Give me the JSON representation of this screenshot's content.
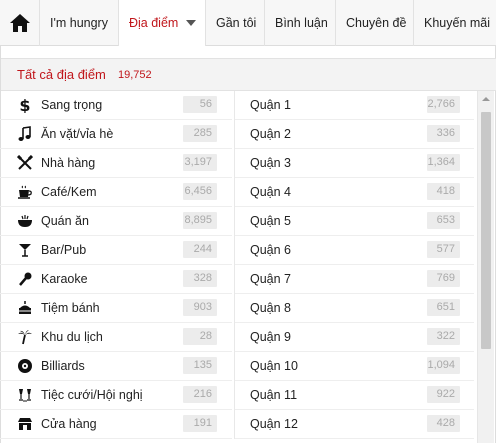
{
  "nav": {
    "home_icon": "home-icon",
    "items": [
      {
        "label": "I'm hungry"
      },
      {
        "label": "Địa điểm"
      },
      {
        "label": "Gần tôi"
      },
      {
        "label": "Bình luận"
      },
      {
        "label": "Chuyên đề"
      },
      {
        "label": "Khuyến mãi"
      }
    ],
    "active_color": "#c0161b"
  },
  "panel": {
    "title": "Tất cả địa điểm",
    "count": "19,752"
  },
  "categories": [
    {
      "label": "Sang trọng",
      "count": "56",
      "icon": "dollar-icon"
    },
    {
      "label": "Ăn vặt/vỉa hè",
      "count": "285",
      "icon": "music-note-icon"
    },
    {
      "label": "Nhà hàng",
      "count": "3,197",
      "icon": "fork-knife-icon"
    },
    {
      "label": "Café/Kem",
      "count": "6,456",
      "icon": "coffee-cup-icon"
    },
    {
      "label": "Quán ăn",
      "count": "8,895",
      "icon": "bowl-icon"
    },
    {
      "label": "Bar/Pub",
      "count": "244",
      "icon": "cocktail-icon"
    },
    {
      "label": "Karaoke",
      "count": "328",
      "icon": "microphone-icon"
    },
    {
      "label": "Tiệm bánh",
      "count": "903",
      "icon": "cake-icon"
    },
    {
      "label": "Khu du lịch",
      "count": "28",
      "icon": "palm-tree-icon"
    },
    {
      "label": "Billiards",
      "count": "135",
      "icon": "billiard-ball-icon"
    },
    {
      "label": "Tiệc cưới/Hội nghị",
      "count": "216",
      "icon": "champagne-glasses-icon"
    },
    {
      "label": "Cửa hàng",
      "count": "191",
      "icon": "shop-icon"
    }
  ],
  "districts": [
    {
      "label": "Quận 1",
      "count": "2,766"
    },
    {
      "label": "Quận 2",
      "count": "336"
    },
    {
      "label": "Quận 3",
      "count": "1,364"
    },
    {
      "label": "Quận 4",
      "count": "418"
    },
    {
      "label": "Quận 5",
      "count": "653"
    },
    {
      "label": "Quận 6",
      "count": "577"
    },
    {
      "label": "Quận 7",
      "count": "769"
    },
    {
      "label": "Quận 8",
      "count": "651"
    },
    {
      "label": "Quận 9",
      "count": "322"
    },
    {
      "label": "Quận 10",
      "count": "1,094"
    },
    {
      "label": "Quận 11",
      "count": "922"
    },
    {
      "label": "Quận 12",
      "count": "428"
    }
  ]
}
